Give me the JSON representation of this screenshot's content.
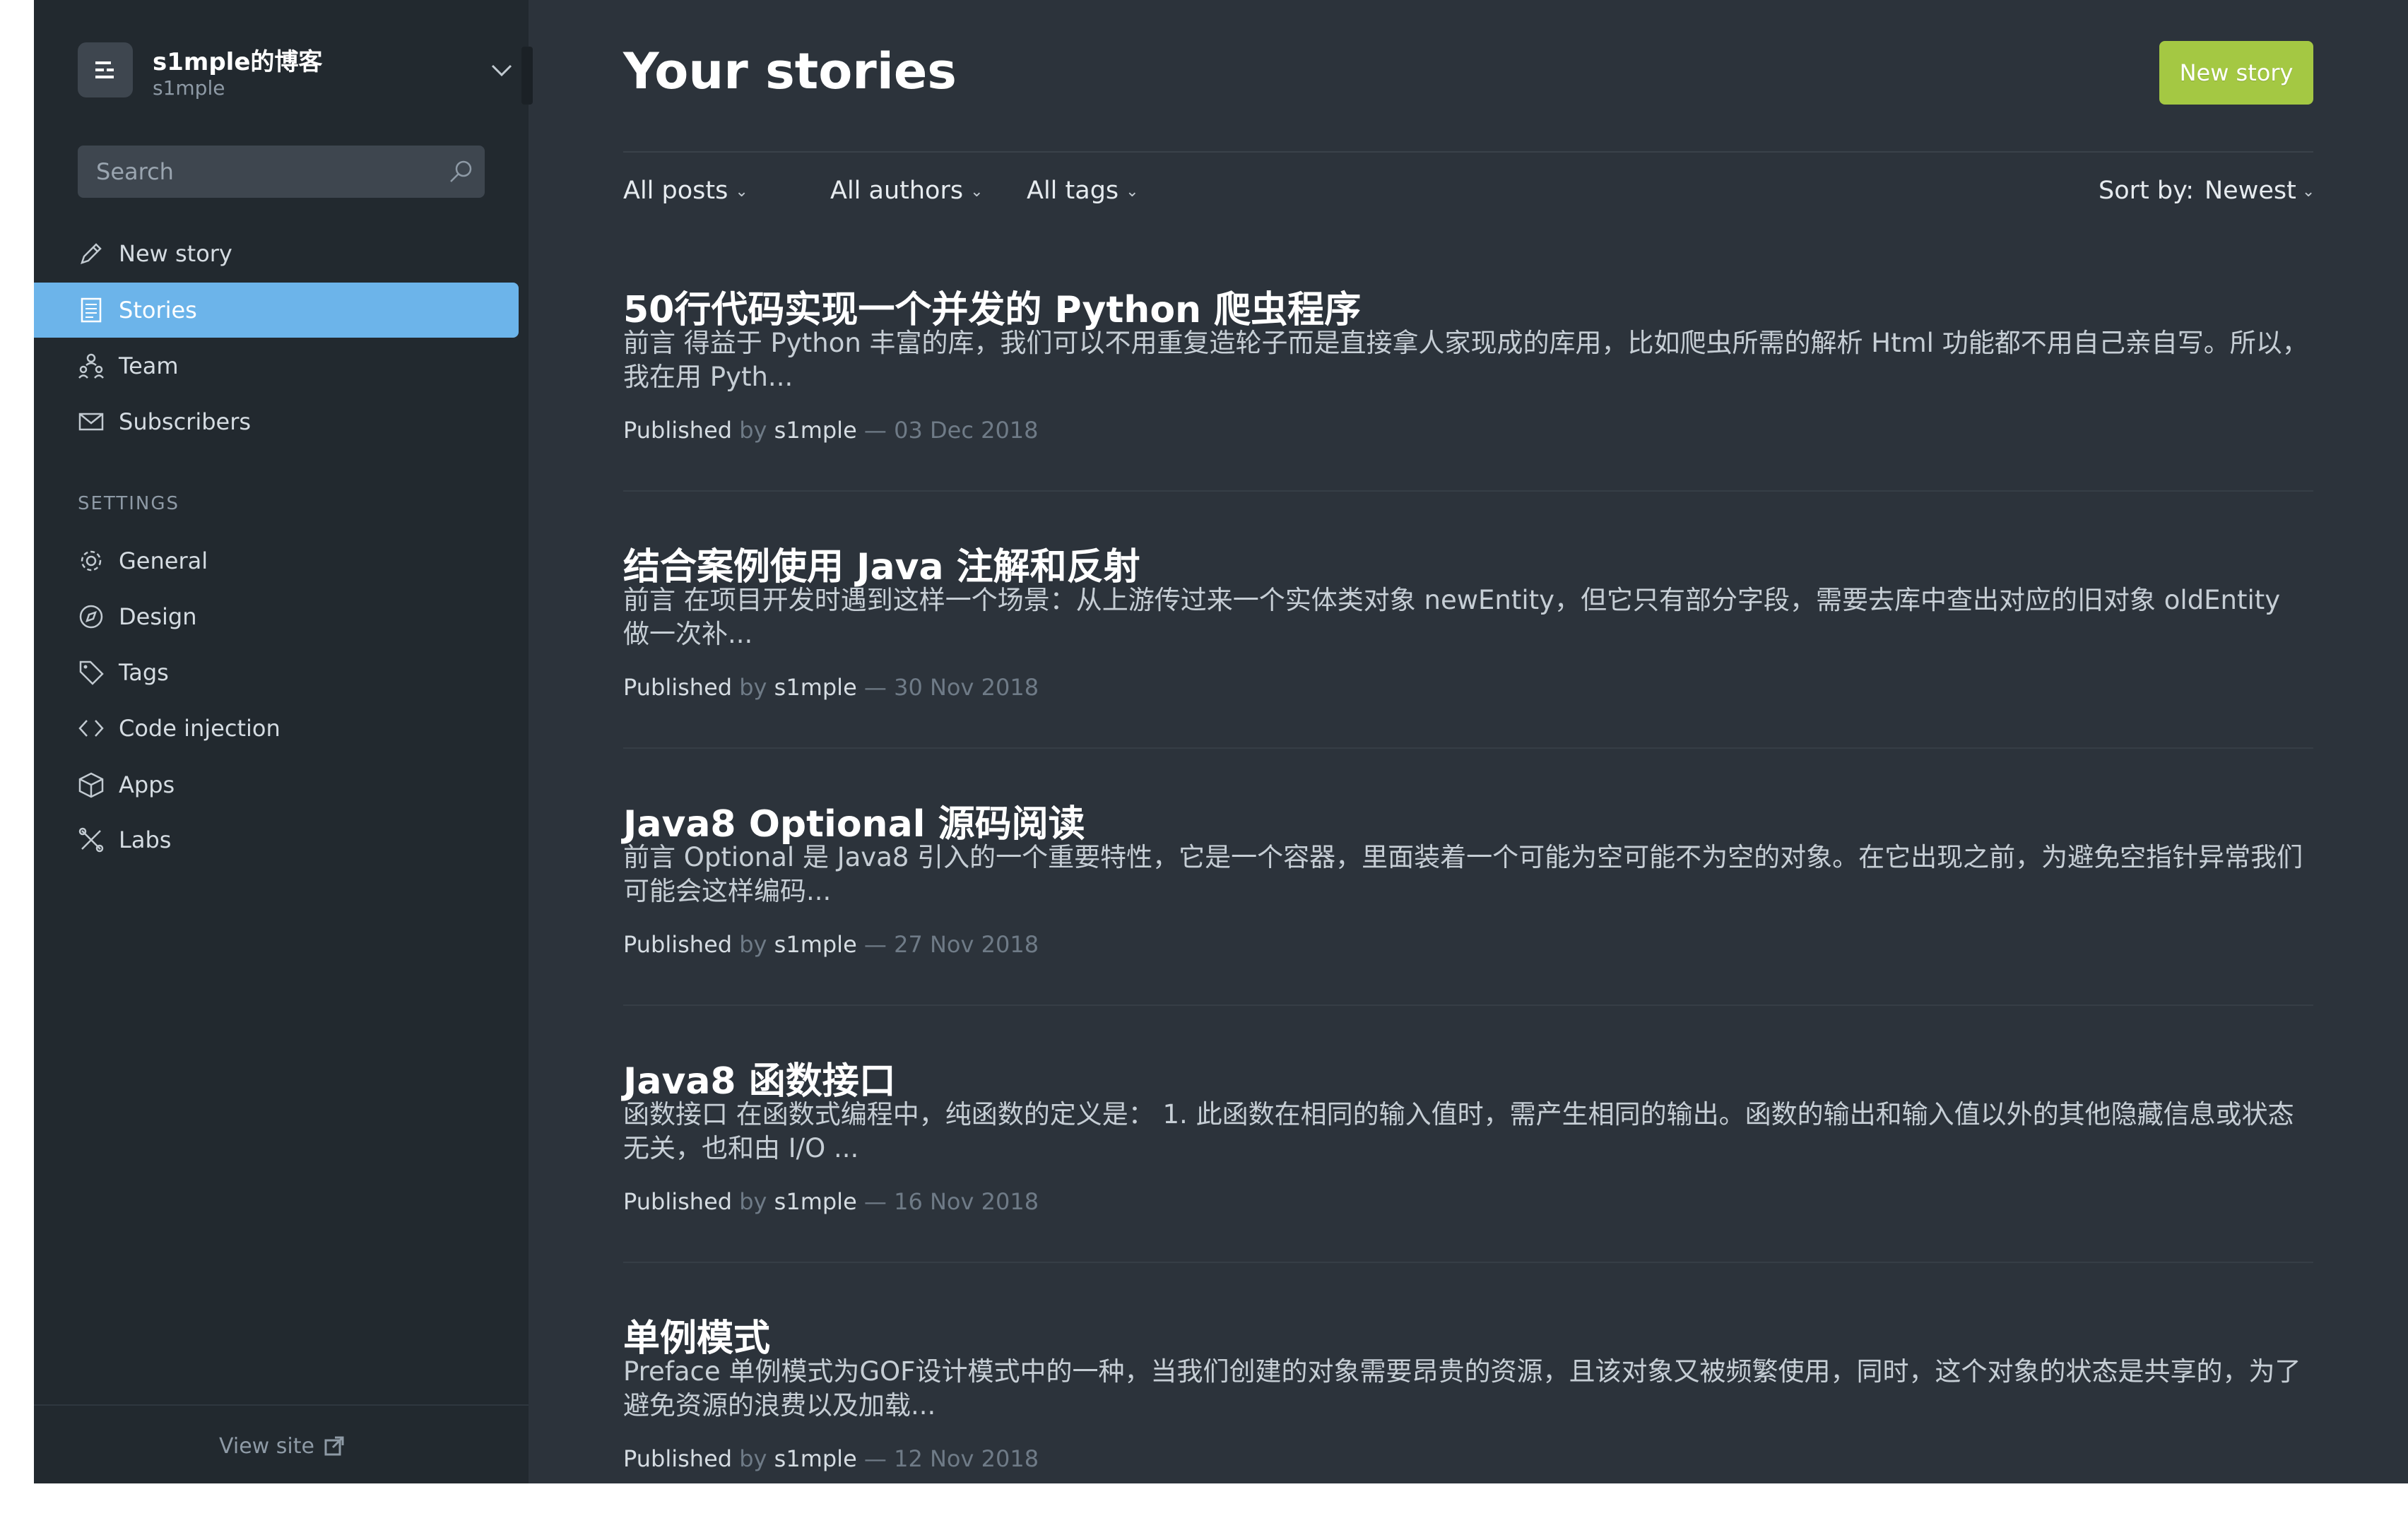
{
  "sidebar": {
    "blog_title": "s1mple的博客",
    "blog_user": "s1mple",
    "search_placeholder": "Search",
    "nav": [
      {
        "label": "New story",
        "icon": "pencil-icon"
      },
      {
        "label": "Stories",
        "icon": "document-icon",
        "active": true
      },
      {
        "label": "Team",
        "icon": "team-icon"
      },
      {
        "label": "Subscribers",
        "icon": "mail-icon"
      }
    ],
    "settings_heading": "SETTINGS",
    "settings": [
      {
        "label": "General",
        "icon": "gear-icon"
      },
      {
        "label": "Design",
        "icon": "compass-icon"
      },
      {
        "label": "Tags",
        "icon": "tag-icon"
      },
      {
        "label": "Code injection",
        "icon": "code-icon"
      },
      {
        "label": "Apps",
        "icon": "box-icon"
      },
      {
        "label": "Labs",
        "icon": "tools-icon"
      }
    ],
    "view_site": "View site"
  },
  "main": {
    "title": "Your stories",
    "new_story_button": "New story",
    "filters": {
      "posts": "All posts",
      "authors": "All authors",
      "tags": "All tags",
      "sort_label": "Sort by:",
      "sort_value": "Newest"
    },
    "posts": [
      {
        "title": "50行代码实现一个并发的 Python 爬虫程序",
        "excerpt": "前言 得益于 Python 丰富的库，我们可以不用重复造轮子而是直接拿人家现成的库用，比如爬虫所需的解析 Html 功能都不用自己亲自写。所以，我在用 Pyth...",
        "status": "Published",
        "by": "by",
        "author": "s1mple",
        "date": "— 03 Dec 2018"
      },
      {
        "title": "结合案例使用 Java 注解和反射",
        "excerpt": "前言 在项目开发时遇到这样一个场景：从上游传过来一个实体类对象 newEntity，但它只有部分字段，需要去库中查出对应的旧对象 oldEntity 做一次补...",
        "status": "Published",
        "by": "by",
        "author": "s1mple",
        "date": "— 30 Nov 2018"
      },
      {
        "title": "Java8 Optional 源码阅读",
        "excerpt": "前言 Optional 是 Java8 引入的一个重要特性，它是一个容器，里面装着一个可能为空可能不为空的对象。在它出现之前，为避免空指针异常我们可能会这样编码...",
        "status": "Published",
        "by": "by",
        "author": "s1mple",
        "date": "— 27 Nov 2018"
      },
      {
        "title": "Java8 函数接口",
        "excerpt": "函数接口 在函数式编程中，纯函数的定义是： 1. 此函数在相同的输入值时，需产生相同的输出。函数的输出和输入值以外的其他隐藏信息或状态无关，也和由 I/O ...",
        "status": "Published",
        "by": "by",
        "author": "s1mple",
        "date": "— 16 Nov 2018"
      },
      {
        "title": "单例模式",
        "excerpt": "Preface 单例模式为GOF设计模式中的一种，当我们创建的对象需要昂贵的资源，且该对象又被频繁使用，同时，这个对象的状态是共享的，为了避免资源的浪费以及加载...",
        "status": "Published",
        "by": "by",
        "author": "s1mple",
        "date": "— 12 Nov 2018"
      }
    ]
  },
  "colors": {
    "sidebar_bg": "#22292f",
    "main_bg": "#2c333b",
    "active_nav": "#6cb4ea",
    "primary_button": "#a4c843"
  }
}
